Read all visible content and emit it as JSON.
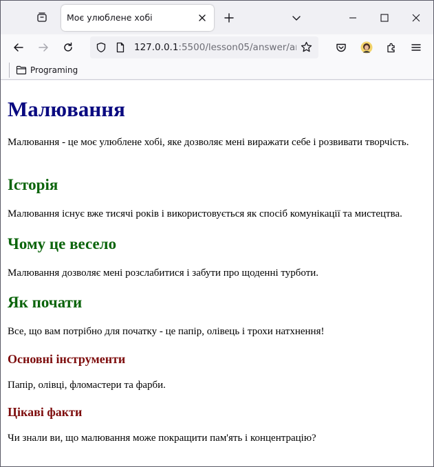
{
  "browser": {
    "tab_title": "Моє улюблене хобі",
    "url_host": "127.0.0.1",
    "url_rest": ":5500/lesson05/answer/answer.html",
    "bookmark_folder": "Programing"
  },
  "page": {
    "title": "Малювання",
    "intro": "Малювання - це моє улюблене хобі, яке дозволяє мені виражати себе і розвивати творчість.",
    "sections": [
      {
        "heading": "Історія",
        "text": "Малювання існує вже тисячі років і використовується як спосіб комунікації та мистецтва."
      },
      {
        "heading": "Чому це весело",
        "text": "Малювання дозволяє мені розслабитися і забути про щоденні турботи."
      },
      {
        "heading": "Як почати",
        "text": "Все, що вам потрібно для початку - це папір, олівець і трохи натхнення!"
      }
    ],
    "subsections": [
      {
        "heading": "Основні інструменти",
        "text": "Папір, олівці, фломастери та фарби."
      },
      {
        "heading": "Цікаві факти",
        "text": "Чи знали ви, що малювання може покращити пам'ять і концентрацію?"
      }
    ]
  },
  "colors": {
    "h1": "#0a0a80",
    "h2": "#0b640b",
    "h3": "#7d0c0c"
  },
  "icons": [
    "tab-list-icon",
    "close-icon",
    "plus-icon",
    "chevron-down-icon",
    "minimize-icon",
    "maximize-icon",
    "back-icon",
    "forward-icon",
    "reload-icon",
    "shield-icon",
    "page-icon",
    "star-icon",
    "pocket-icon",
    "avatar",
    "extensions-icon",
    "menu-icon",
    "folder-icon"
  ]
}
